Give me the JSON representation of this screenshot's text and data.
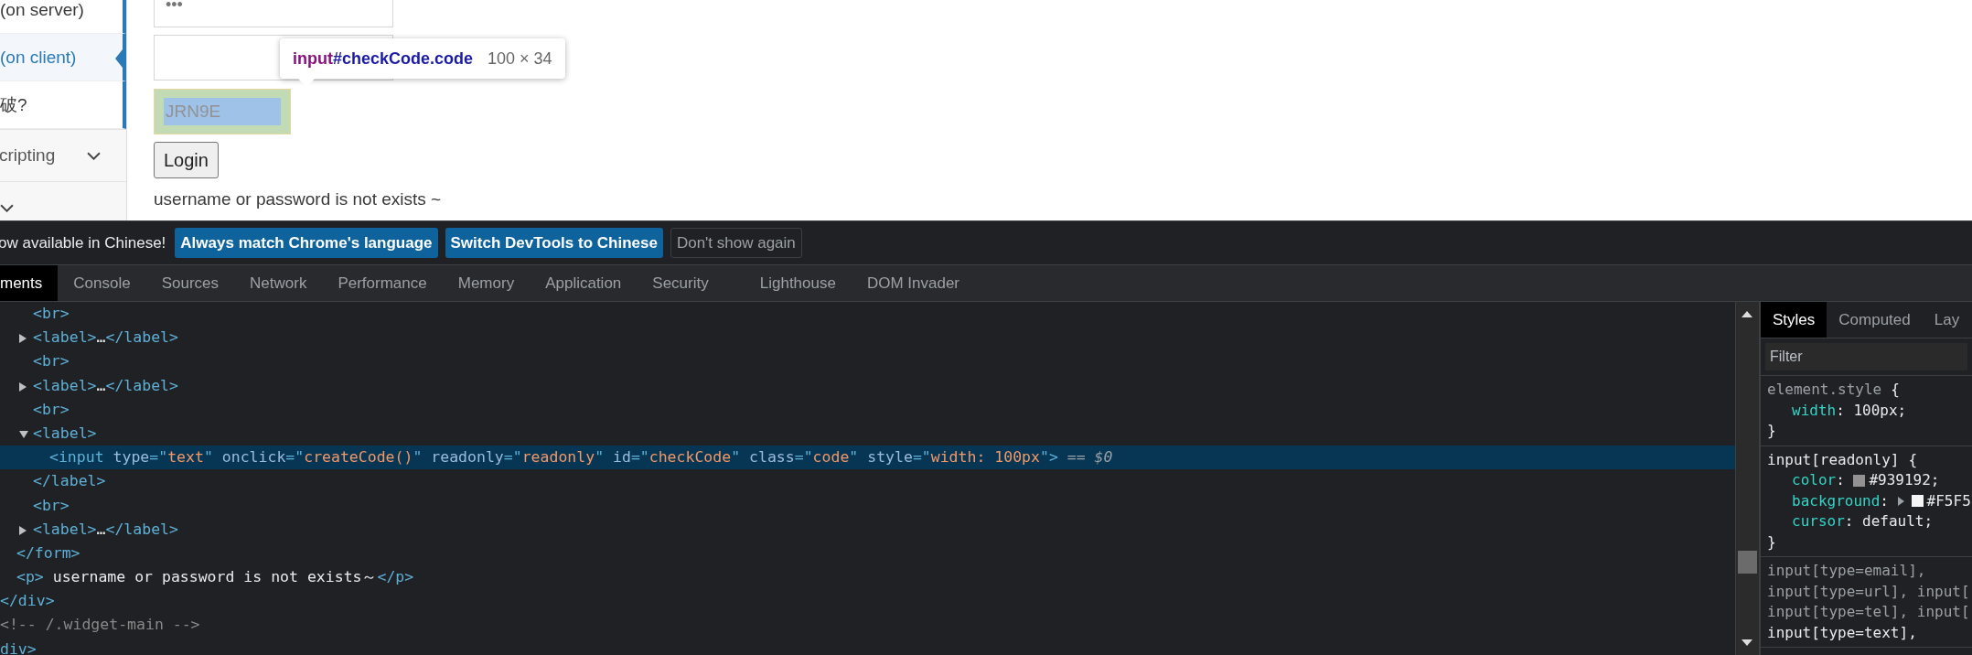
{
  "page": {
    "sidebar": {
      "items": [
        {
          "kind": "link",
          "label": "(on server)",
          "selected": false
        },
        {
          "kind": "link",
          "label": "(on client)",
          "selected": true
        },
        {
          "kind": "link",
          "label": "破?",
          "selected": false
        },
        {
          "kind": "group",
          "label": "cripting"
        },
        {
          "kind": "group"
        }
      ]
    },
    "form": {
      "password": {
        "value": "•••"
      },
      "check_code": {
        "value": "JRN9E",
        "highlighted": true
      },
      "login_button": "Login",
      "message": "username or password is not exists ~"
    },
    "tooltip": {
      "tag": "input",
      "selector": "#checkCode.code",
      "size": "100 × 34"
    }
  },
  "devtools": {
    "infobar": {
      "message": "ow available in Chinese!",
      "buttons": [
        {
          "label": "Always match Chrome's language",
          "kind": "primary"
        },
        {
          "label": "Switch DevTools to Chinese",
          "kind": "primary"
        },
        {
          "label": "Don't show again",
          "kind": "secondary"
        }
      ]
    },
    "tabs": [
      {
        "label": "ments",
        "selected": true
      },
      {
        "label": "Console",
        "selected": false
      },
      {
        "label": "Sources",
        "selected": false
      },
      {
        "label": "Network",
        "selected": false
      },
      {
        "label": "Performance",
        "selected": false
      },
      {
        "label": "Memory",
        "selected": false
      },
      {
        "label": "Application",
        "selected": false
      },
      {
        "label": "Security",
        "selected": false
      },
      {
        "label": "Lighthouse",
        "selected": false
      },
      {
        "label": "DOM Invader",
        "selected": false
      }
    ],
    "dom": [
      {
        "close": [
          {
            "kind": "tag",
            "s": "</div>"
          }
        ],
        "children": [
          {
            "close": [
              {
                "kind": "tag",
                "s": "</form>"
              }
            ],
            "children": [
              {
                "line": [
                  {
                    "kind": "tag",
                    "s": "<br>"
                  }
                ],
                "selected": false
              },
              {
                "expanded": false,
                "line": [
                  {
                    "kind": "tag",
                    "s": "<label>"
                  },
                  {
                    "kind": "text",
                    "s": "…"
                  },
                  {
                    "kind": "tag",
                    "s": "</label>"
                  }
                ],
                "selected": false
              },
              {
                "line": [
                  {
                    "kind": "tag",
                    "s": "<br>"
                  }
                ],
                "selected": false
              },
              {
                "expanded": false,
                "line": [
                  {
                    "kind": "tag",
                    "s": "<label>"
                  },
                  {
                    "kind": "text",
                    "s": "…"
                  },
                  {
                    "kind": "tag",
                    "s": "</label>"
                  }
                ],
                "selected": false
              },
              {
                "line": [
                  {
                    "kind": "tag",
                    "s": "<br>"
                  }
                ],
                "selected": false
              },
              {
                "expanded": true,
                "line": [
                  {
                    "kind": "tag",
                    "s": "<label>"
                  }
                ],
                "selected": false,
                "close": [
                  {
                    "kind": "tag",
                    "s": "</label>"
                  }
                ],
                "children": [
                  {
                    "line": [
                      {
                        "kind": "tag",
                        "s": "<input"
                      },
                      {
                        "kind": "attr",
                        "s": " type"
                      },
                      {
                        "kind": "tag",
                        "s": "=\""
                      },
                      {
                        "kind": "value",
                        "s": "text"
                      },
                      {
                        "kind": "tag",
                        "s": "\""
                      },
                      {
                        "kind": "attr",
                        "s": " onclick"
                      },
                      {
                        "kind": "tag",
                        "s": "=\""
                      },
                      {
                        "kind": "value",
                        "s": "createCode()"
                      },
                      {
                        "kind": "tag",
                        "s": "\""
                      },
                      {
                        "kind": "attr",
                        "s": " readonly"
                      },
                      {
                        "kind": "tag",
                        "s": "=\""
                      },
                      {
                        "kind": "value",
                        "s": "readonly"
                      },
                      {
                        "kind": "tag",
                        "s": "\""
                      },
                      {
                        "kind": "attr",
                        "s": " id"
                      },
                      {
                        "kind": "tag",
                        "s": "=\""
                      },
                      {
                        "kind": "value",
                        "s": "checkCode"
                      },
                      {
                        "kind": "tag",
                        "s": "\""
                      },
                      {
                        "kind": "attr",
                        "s": " class"
                      },
                      {
                        "kind": "tag",
                        "s": "=\""
                      },
                      {
                        "kind": "value",
                        "s": "code"
                      },
                      {
                        "kind": "tag",
                        "s": "\""
                      },
                      {
                        "kind": "attr",
                        "s": " style"
                      },
                      {
                        "kind": "tag",
                        "s": "=\""
                      },
                      {
                        "kind": "value",
                        "s": "width: 100px"
                      },
                      {
                        "kind": "tag",
                        "s": "\">"
                      },
                      {
                        "kind": "marker",
                        "s": " == $0"
                      }
                    ],
                    "selected": true
                  }
                ]
              },
              {
                "line": [
                  {
                    "kind": "tag",
                    "s": "<br>"
                  }
                ],
                "selected": false
              },
              {
                "expanded": false,
                "line": [
                  {
                    "kind": "tag",
                    "s": "<label>"
                  },
                  {
                    "kind": "text",
                    "s": "…"
                  },
                  {
                    "kind": "tag",
                    "s": "</label>"
                  }
                ],
                "selected": false
              }
            ]
          },
          {
            "line": [
              {
                "kind": "tag",
                "s": "<p>"
              },
              {
                "kind": "text",
                "s": " username or password is not exists～"
              },
              {
                "kind": "tag",
                "s": "</p>"
              }
            ],
            "selected": false
          }
        ]
      },
      {
        "line": [
          {
            "kind": "comment",
            "s": "<!-- /.widget-main -->"
          }
        ],
        "selected": false
      },
      {
        "line": [
          {
            "kind": "tag",
            "s": "div>"
          }
        ],
        "selected": false
      }
    ],
    "styles": {
      "tabs": [
        {
          "label": "Styles",
          "selected": true
        },
        {
          "label": "Computed",
          "selected": false
        },
        {
          "label": "Lay",
          "selected": false
        }
      ],
      "filter": {
        "placeholder": "Filter"
      },
      "rules": [
        {
          "selectors": [
            {
              "text": "element.style",
              "matched": false
            }
          ],
          "open": "{",
          "close": "}",
          "declarations": [
            {
              "property": "width",
              "value": ": 100px;"
            }
          ]
        },
        {
          "selectors": [
            {
              "text": "input[readonly]",
              "matched": true
            }
          ],
          "open": "{",
          "close": "}",
          "declarations": [
            {
              "property": "color",
              "separator": ": ",
              "value": "#939192;",
              "color": "#939192",
              "expandable": false
            },
            {
              "property": "background",
              "separator": ": ",
              "value": "#F5F5",
              "color": "#f5f5f5",
              "expandable": true
            },
            {
              "property": "cursor",
              "value": ": default;"
            }
          ]
        },
        {
          "selectors": [
            {
              "text": "input[type=email],",
              "matched": false
            },
            {
              "text": "input[type=url], input[",
              "matched": false
            },
            {
              "text": "input[type=tel], input[",
              "matched": false
            },
            {
              "text": "input[type=text],",
              "matched": true
            }
          ]
        }
      ]
    }
  }
}
